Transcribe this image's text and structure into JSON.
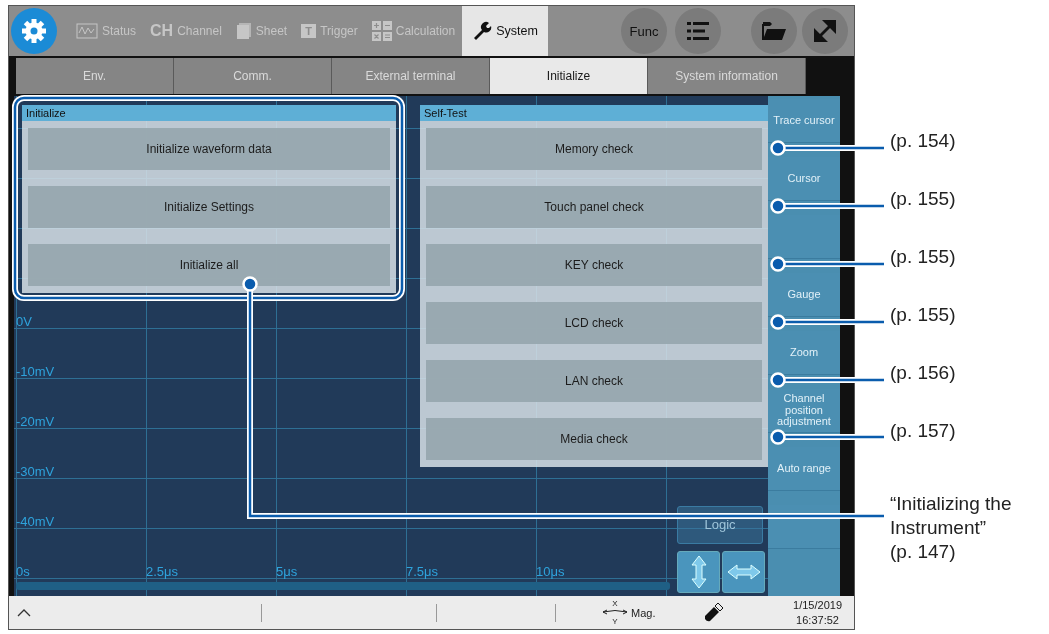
{
  "top_bar": {
    "tabs": [
      {
        "label": "Status",
        "selected": false
      },
      {
        "label": "Channel",
        "icon_text": "CH",
        "selected": false
      },
      {
        "label": "Sheet",
        "selected": false
      },
      {
        "label": "Trigger",
        "icon_text": "T",
        "selected": false
      },
      {
        "label": "Calculation",
        "selected": false
      },
      {
        "label": "System",
        "selected": true
      }
    ],
    "func_button": "Func"
  },
  "sub_tabs": [
    {
      "label": "Env.",
      "selected": false
    },
    {
      "label": "Comm.",
      "selected": false
    },
    {
      "label": "External terminal",
      "selected": false
    },
    {
      "label": "Initialize",
      "selected": true
    },
    {
      "label": "System information",
      "selected": false
    }
  ],
  "waveform": {
    "y_labels": [
      "0V",
      "-10mV",
      "-20mV",
      "-30mV",
      "-40mV"
    ],
    "x_labels": [
      "0s",
      "2.5μs",
      "5μs",
      "7.5μs",
      "10μs"
    ],
    "logic_button": "Logic"
  },
  "side_panel": {
    "items": [
      {
        "kind": "label",
        "label": "Trace cursor"
      },
      {
        "kind": "label",
        "label": "Cursor"
      },
      {
        "kind": "blank"
      },
      {
        "kind": "label",
        "label": "Gauge"
      },
      {
        "kind": "label",
        "label": "Zoom"
      },
      {
        "kind": "label",
        "label": "Channel position adjustment"
      },
      {
        "kind": "label",
        "label": "Auto range"
      },
      {
        "kind": "blank"
      }
    ]
  },
  "initialize_dialog": {
    "title": "Initialize",
    "buttons": [
      "Initialize waveform data",
      "Initialize Settings",
      "Initialize all"
    ]
  },
  "self_test_dialog": {
    "title": "Self-Test",
    "buttons": [
      {
        "label": "Memory check",
        "page_ref": "(p. 154)"
      },
      {
        "label": "Touch panel check",
        "page_ref": "(p. 155)"
      },
      {
        "label": "KEY check",
        "page_ref": "(p. 155)"
      },
      {
        "label": "LCD check",
        "page_ref": "(p. 155)"
      },
      {
        "label": "LAN check",
        "page_ref": "(p. 156)"
      },
      {
        "label": "Media check",
        "page_ref": "(p. 157)"
      }
    ]
  },
  "initialize_callout": "“Initializing the\nInstrument”\n(p. 147)",
  "status_bar": {
    "mag_label": "Mag.",
    "x_label": "X",
    "y_label": "Y",
    "date": "1/15/2019",
    "time": "16:37:52"
  }
}
